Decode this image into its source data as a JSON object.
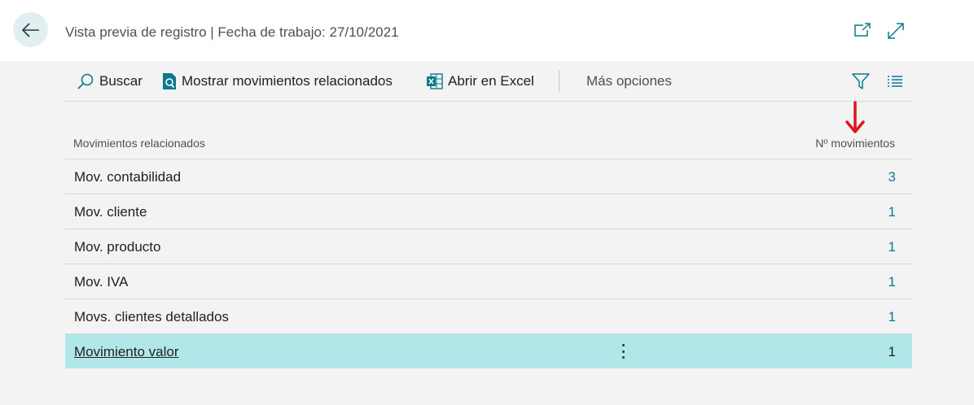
{
  "header": {
    "title": "Vista previa de registro | Fecha de trabajo: 27/10/2021",
    "back_icon": "back-arrow-icon",
    "open_new_window_icon": "open-new-window-icon",
    "expand_icon": "expand-icon"
  },
  "toolbar": {
    "search_label": "Buscar",
    "show_related_label": "Mostrar movimientos relacionados",
    "open_excel_label": "Abrir en Excel",
    "more_options_label": "Más opciones",
    "filter_icon": "filter-icon",
    "list_view_icon": "list-view-icon"
  },
  "annotation": {
    "arrow_color": "#e0161b"
  },
  "grid": {
    "columns": [
      "Movimientos relacionados",
      "Nº movimientos"
    ],
    "rows": [
      {
        "name": "Mov. contabilidad",
        "count": "3"
      },
      {
        "name": "Mov. cliente",
        "count": "1"
      },
      {
        "name": "Mov. producto",
        "count": "1"
      },
      {
        "name": "Mov. IVA",
        "count": "1"
      },
      {
        "name": "Movs. clientes detallados",
        "count": "1"
      },
      {
        "name": "Movimiento valor",
        "count": "1"
      }
    ],
    "selected_row": 5
  },
  "colors": {
    "accent": "#0a7b8c",
    "selected_row_bg": "#b2e7ea",
    "back_button_bg": "#dfeff2"
  }
}
